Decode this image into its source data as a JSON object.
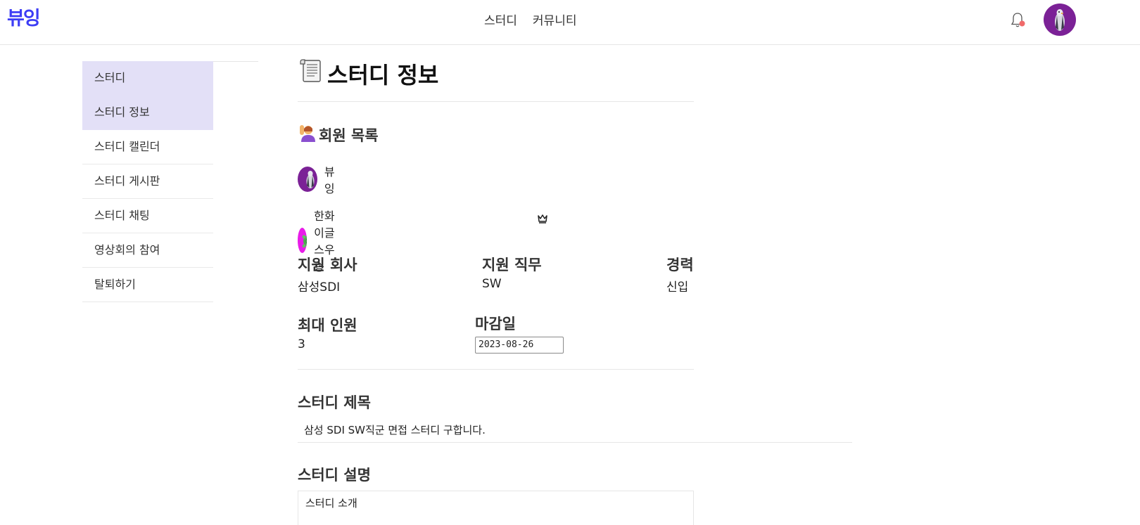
{
  "header": {
    "logo": "뷰잉",
    "nav": [
      "스터디",
      "커뮤니티"
    ]
  },
  "sidebar": {
    "items": [
      {
        "label": "스터디",
        "active": true
      },
      {
        "label": "스터디 정보",
        "active": true
      },
      {
        "label": "스터디 캘린더",
        "active": false
      },
      {
        "label": "스터디 게시판",
        "active": false
      },
      {
        "label": "스터디 채팅",
        "active": false
      },
      {
        "label": "영상회의 참여",
        "active": false
      },
      {
        "label": "탈퇴하기",
        "active": false
      }
    ]
  },
  "main": {
    "title": "스터디 정보",
    "members_title": "회원 목록",
    "members": [
      {
        "name": "뷰잉",
        "avatar": "penguin-avatar"
      },
      {
        "name": "한화이글스우승",
        "avatar": "turtle-avatar",
        "leader": true
      }
    ],
    "fields": {
      "company_label": "지원 회사",
      "company_value": "삼성SDI",
      "role_label": "지원 직무",
      "role_value": "SW",
      "career_label": "경력",
      "career_value": "신입",
      "max_label": "최대 인원",
      "max_value": "3",
      "deadline_label": "마감일",
      "deadline_value": "2023-08-26"
    },
    "study_title_label": "스터디 제목",
    "study_title_value": "삼성 SDI SW직군 면접 스터디 구합니다.",
    "study_desc_label": "스터디 설명",
    "study_desc_value": "스터디 소개"
  },
  "colors": {
    "brand": "#3d3df5",
    "sidebar_active": "#e3e0f7",
    "avatar_purple": "#7b2196",
    "avatar_magenta": "#e81ce8",
    "notification_dot": "#f06a6a"
  }
}
